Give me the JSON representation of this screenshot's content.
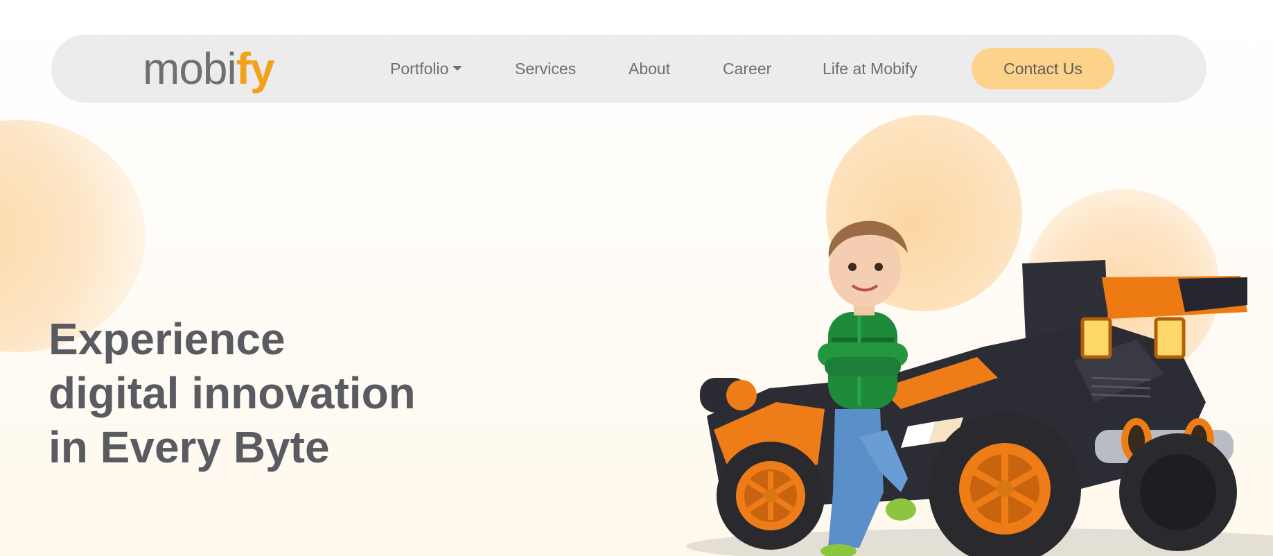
{
  "brand": {
    "logo_part1": "mobi",
    "logo_part2": "fy"
  },
  "nav": {
    "items": [
      {
        "label": "Portfolio"
      },
      {
        "label": "Services"
      },
      {
        "label": "About"
      },
      {
        "label": "Career"
      },
      {
        "label": "Life at Mobify"
      }
    ],
    "contact_label": "Contact Us"
  },
  "hero": {
    "title_lines": [
      "Experience",
      "digital innovation",
      "in Every Byte"
    ]
  },
  "colors": {
    "accent": "#f2a218",
    "button_bg": "#fdd28a",
    "nav_bg": "#ececec",
    "text": "#595b61"
  },
  "icons": {
    "portfolio_dropdown": "caret-down-icon"
  }
}
